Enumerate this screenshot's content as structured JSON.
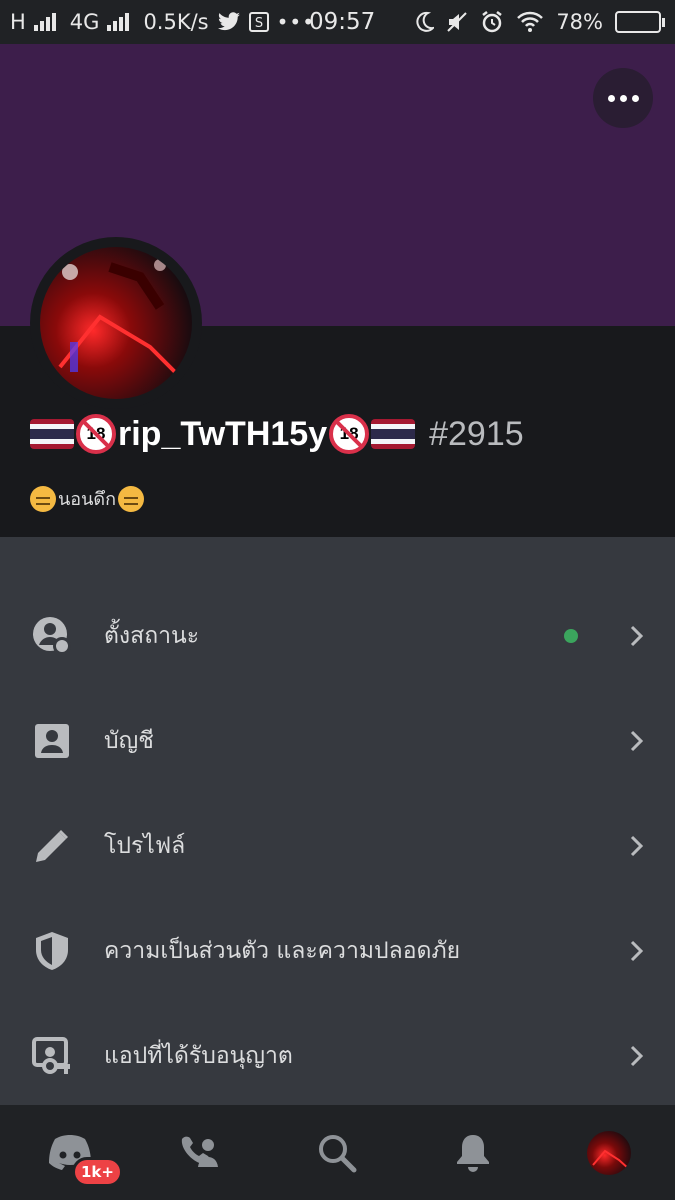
{
  "status_bar": {
    "carrier_1": "H",
    "network": "4G",
    "speed": "0.5K/s",
    "time": "09:57",
    "battery": "78%",
    "battery_level": 0.78
  },
  "profile": {
    "username": "rip_TwTH15y",
    "badge_text": "18",
    "discriminator": "#2915",
    "custom_status": "นอนดึก"
  },
  "settings": [
    {
      "label": "ตั้งสถานะ",
      "icon": "set-status-icon",
      "status_color": "#3ba55d"
    },
    {
      "label": "บัญชี",
      "icon": "account-icon"
    },
    {
      "label": "โปรไฟล์",
      "icon": "pencil-icon"
    },
    {
      "label": "ความเป็นส่วนตัว และความปลอดภัย",
      "icon": "shield-icon"
    },
    {
      "label": "แอปที่ได้รับอนุญาต",
      "icon": "authorized-apps-icon"
    }
  ],
  "bottom_nav": {
    "home_badge": "1k+",
    "items": [
      "home-icon",
      "friends-icon",
      "search-icon",
      "bell-icon",
      "avatar"
    ]
  },
  "colors": {
    "banner": "#3d1e4b",
    "profile_bg": "#18191c",
    "list_bg": "#36393f",
    "nav_bg": "#202225",
    "online": "#3ba55d",
    "badge": "#ed4245"
  }
}
